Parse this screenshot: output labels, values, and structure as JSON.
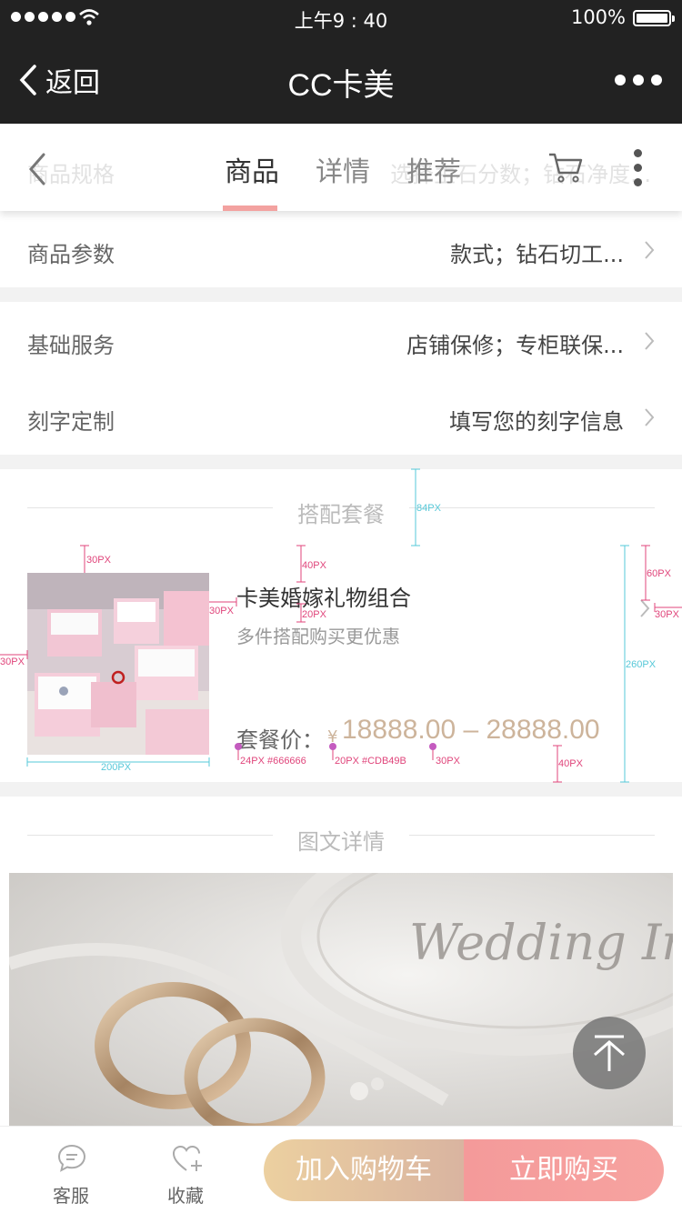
{
  "status_bar": {
    "time": "上午9 : 40",
    "battery": "100%"
  },
  "nav": {
    "back_label": "返回",
    "title": "CC卡美"
  },
  "tabs": {
    "items": [
      {
        "label": "商品",
        "active": true
      },
      {
        "label": "详情",
        "active": false
      },
      {
        "label": "推荐",
        "active": false
      }
    ],
    "underlying_row": {
      "label": "商品规格",
      "value": "选择主石分数；钻石净度..."
    }
  },
  "rows": {
    "params": {
      "label": "商品参数",
      "value": "款式；钻石切工..."
    },
    "service": {
      "label": "基础服务",
      "value": "店铺保修；专柜联保..."
    },
    "engrave": {
      "label": "刻字定制",
      "value": "填写您的刻字信息"
    }
  },
  "combo_section": {
    "title": "搭配套餐",
    "name": "卡美婚嫁礼物组合",
    "subtitle": "多件搭配购买更优惠",
    "price_label": "套餐价：",
    "currency": "¥",
    "price": "18888.00 – 28888.00",
    "price_color": "#CDB49B"
  },
  "annotations": {
    "a84": "84PX",
    "a30a": "30PX",
    "a40a": "40PX",
    "a30b": "30PX",
    "a20": "20PX",
    "a60": "60PX",
    "a30c": "30PX",
    "a30d": "30PX",
    "a260": "260PX",
    "a200": "200PX",
    "a24c": "24PX #666666",
    "a20c": "20PX #CDB49B",
    "a30e": "30PX",
    "a40b": "40PX"
  },
  "detail_section": {
    "title": "图文详情",
    "script_text": "Wedding Invita"
  },
  "bottom_bar": {
    "service_label": "客服",
    "favorite_label": "收藏",
    "add_cart_label": "加入购物车",
    "buy_label": "立即购买"
  },
  "colors": {
    "accent_pink": "#F3A2A0",
    "gold": "#CDB49B",
    "dark_nav": "#222222"
  }
}
